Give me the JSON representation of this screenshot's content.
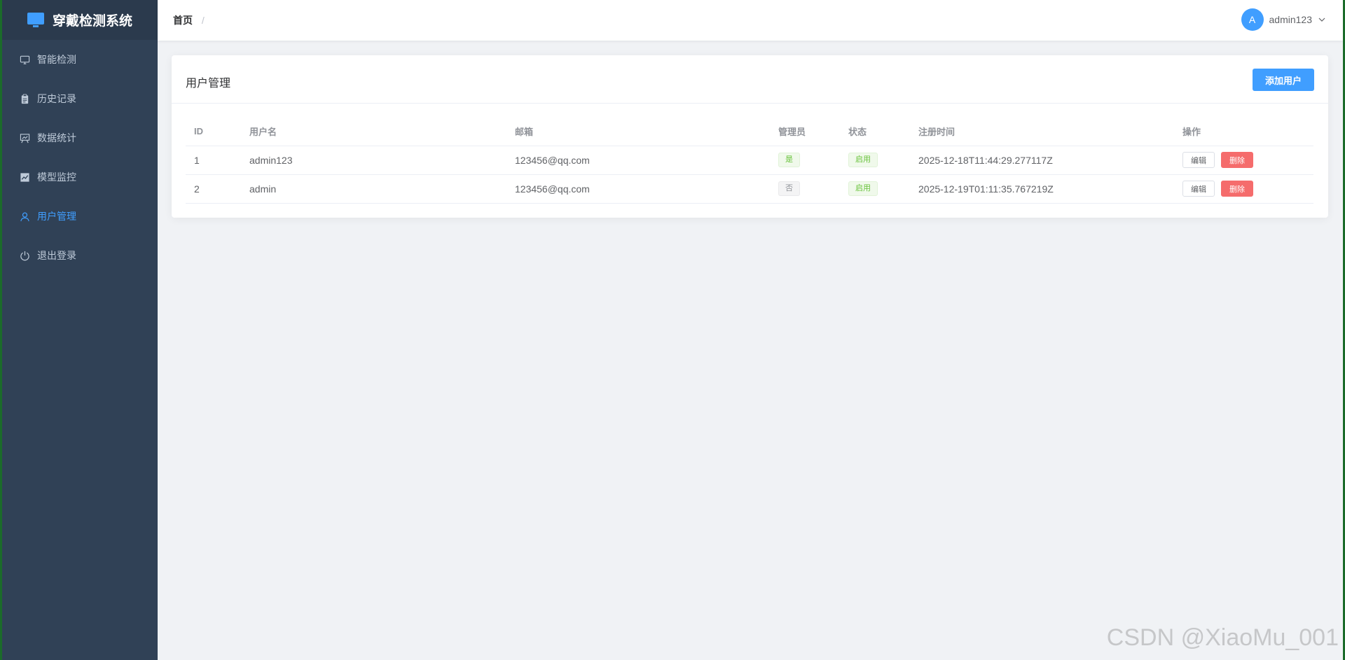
{
  "app": {
    "title": "穿戴检测系统",
    "logo_icon": "monitor-icon"
  },
  "sidebar": {
    "items": [
      {
        "label": "智能检测",
        "icon": "monitor-icon",
        "active": false
      },
      {
        "label": "历史记录",
        "icon": "clipboard-icon",
        "active": false
      },
      {
        "label": "数据统计",
        "icon": "presentation-chart-icon",
        "active": false
      },
      {
        "label": "模型监控",
        "icon": "trend-chart-icon",
        "active": false
      },
      {
        "label": "用户管理",
        "icon": "user-icon",
        "active": true
      },
      {
        "label": "退出登录",
        "icon": "power-icon",
        "active": false
      }
    ]
  },
  "header": {
    "breadcrumb_home": "首页",
    "breadcrumb_sep": "/",
    "user": {
      "avatar_letter": "A",
      "name": "admin123"
    }
  },
  "card": {
    "title": "用户管理",
    "add_label": "添加用户"
  },
  "table": {
    "columns": [
      "ID",
      "用户名",
      "邮箱",
      "管理员",
      "状态",
      "注册时间",
      "操作"
    ],
    "rows": [
      {
        "id": "1",
        "username": "admin123",
        "email": "123456@qq.com",
        "admin": "是",
        "status": "启用",
        "registered": "2025-12-18T11:44:29.277117Z",
        "edit": "编辑",
        "delete": "删除"
      },
      {
        "id": "2",
        "username": "admin",
        "email": "123456@qq.com",
        "admin": "否",
        "status": "启用",
        "registered": "2025-12-19T01:11:35.767219Z",
        "edit": "编辑",
        "delete": "删除"
      }
    ]
  },
  "watermark": "CSDN @XiaoMu_001",
  "colors": {
    "primary": "#409eff",
    "sidebar_bg": "#304156",
    "danger": "#f56c6c",
    "success": "#67c23a"
  }
}
